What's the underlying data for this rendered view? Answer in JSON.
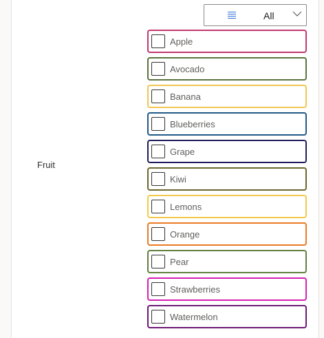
{
  "filter": {
    "icon": "list-icon",
    "value": "All",
    "chevron": "chevron-down-icon"
  },
  "field": {
    "label": "Fruit"
  },
  "options": [
    {
      "label": "Apple",
      "color": "#c0376e",
      "checked": false
    },
    {
      "label": "Avocado",
      "color": "#58733c",
      "checked": false
    },
    {
      "label": "Banana",
      "color": "#f1c550",
      "checked": false
    },
    {
      "label": "Blueberries",
      "color": "#1f5a86",
      "checked": false
    },
    {
      "label": "Grape",
      "color": "#1c1c5c",
      "checked": false
    },
    {
      "label": "Kiwi",
      "color": "#6b6529",
      "checked": false
    },
    {
      "label": "Lemons",
      "color": "#f4c94a",
      "checked": false
    },
    {
      "label": "Orange",
      "color": "#ea7a23",
      "checked": false
    },
    {
      "label": "Pear",
      "color": "#5f7f3e",
      "checked": false
    },
    {
      "label": "Strawberries",
      "color": "#d61eb2",
      "checked": false
    },
    {
      "label": "Watermelon",
      "color": "#6b1574",
      "checked": false
    }
  ]
}
